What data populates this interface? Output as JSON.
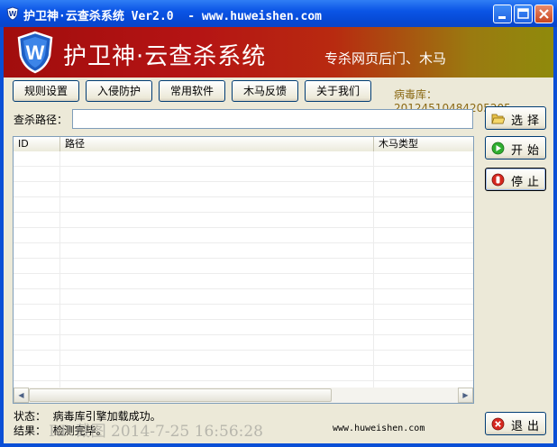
{
  "window": {
    "title": "护卫神·云查杀系统 Ver2.0  - www.huweishen.com"
  },
  "banner": {
    "title": "护卫神·云查杀系统",
    "subtitle": "专杀网页后门、木马"
  },
  "toolbar": {
    "buttons": [
      "规则设置",
      "入侵防护",
      "常用软件",
      "木马反馈",
      "关于我们"
    ]
  },
  "virus_db": {
    "label": "病毒库：20124510484205205"
  },
  "path": {
    "label": "查杀路径：",
    "value": ""
  },
  "table": {
    "columns": [
      "ID",
      "路径",
      "木马类型"
    ],
    "rows": []
  },
  "side_buttons": {
    "select": "选择",
    "start": "开始",
    "stop": "停止",
    "exit": "退出"
  },
  "status": {
    "state": "状态：  病毒库引擎加载成功。",
    "result": "结果：  检测完毕。"
  },
  "watermark": "RP 截图 2014-7-25 16:56:28",
  "footer": {
    "site": "www.huweishen.com"
  },
  "colors": {
    "titlebar": "#0b55e6",
    "banner_left": "#a10d0d",
    "banner_right": "#8f8a0c",
    "virus_db_text": "#8b6914"
  }
}
